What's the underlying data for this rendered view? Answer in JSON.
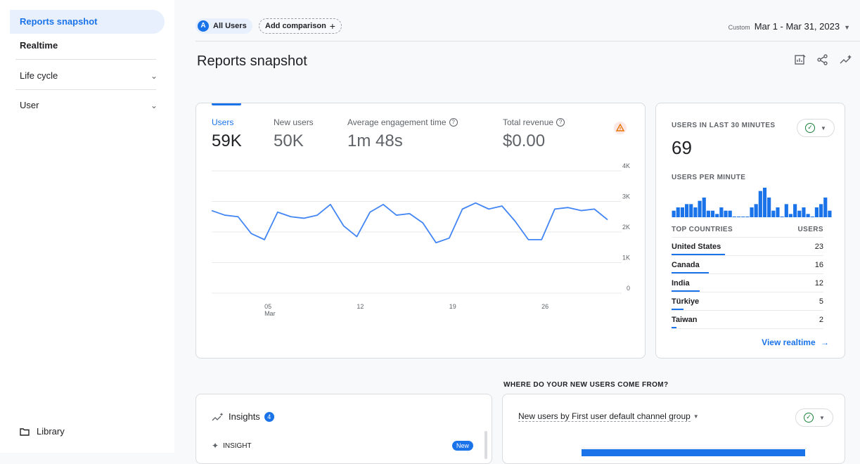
{
  "sidebar": {
    "items": [
      {
        "label": "Reports snapshot"
      },
      {
        "label": "Realtime"
      },
      {
        "label": "Life cycle"
      },
      {
        "label": "User"
      }
    ],
    "library_label": "Library"
  },
  "header": {
    "segment_initial": "A",
    "segment_label": "All Users",
    "add_comparison_label": "Add comparison",
    "date_prefix": "Custom",
    "date_range": "Mar 1 - Mar 31, 2023"
  },
  "page": {
    "title": "Reports snapshot"
  },
  "metrics": [
    {
      "label": "Users",
      "value": "59K"
    },
    {
      "label": "New users",
      "value": "50K"
    },
    {
      "label": "Average engagement time",
      "value": "1m 48s"
    },
    {
      "label": "Total revenue",
      "value": "$0.00"
    }
  ],
  "chart_data": {
    "type": "line",
    "x": [
      "01",
      "02",
      "03",
      "04",
      "05",
      "06",
      "07",
      "08",
      "09",
      "10",
      "11",
      "12",
      "13",
      "14",
      "15",
      "16",
      "17",
      "18",
      "19",
      "20",
      "21",
      "22",
      "23",
      "24",
      "25",
      "26",
      "27",
      "28",
      "29",
      "30",
      "31"
    ],
    "x_tick_labels": [
      {
        "at": "05",
        "label": "05",
        "sub": "Mar"
      },
      {
        "at": "12",
        "label": "12"
      },
      {
        "at": "19",
        "label": "19"
      },
      {
        "at": "26",
        "label": "26"
      }
    ],
    "series": [
      {
        "color": "#4285f4",
        "values": [
          2700,
          2550,
          2500,
          1950,
          1750,
          2650,
          2500,
          2450,
          2550,
          2900,
          2200,
          1850,
          2650,
          2900,
          2550,
          2600,
          2300,
          1650,
          1800,
          2750,
          2950,
          2750,
          2850,
          2350,
          1750,
          1750,
          2750,
          2800,
          2700,
          2750,
          2400
        ]
      }
    ],
    "ylim": [
      0,
      4000
    ],
    "y_ticks": [
      {
        "v": 0,
        "label": "0"
      },
      {
        "v": 1000,
        "label": "1K"
      },
      {
        "v": 2000,
        "label": "2K"
      },
      {
        "v": 3000,
        "label": "3K"
      },
      {
        "v": 4000,
        "label": "4K"
      }
    ],
    "grid": true
  },
  "realtime": {
    "title": "USERS IN LAST 30 MINUTES",
    "value": "69",
    "per_minute_label": "USERS PER MINUTE",
    "per_minute": [
      2,
      3,
      3,
      4,
      4,
      3,
      5,
      6,
      2,
      2,
      1,
      3,
      2,
      2,
      0,
      0,
      0,
      0,
      3,
      4,
      8,
      9,
      6,
      2,
      3,
      0,
      4,
      1,
      4,
      2,
      3,
      1,
      0,
      3,
      4,
      6,
      2
    ],
    "countries_header": "TOP COUNTRIES",
    "users_header": "USERS",
    "countries": [
      {
        "name": "United States",
        "value": "23",
        "frac": 1.0
      },
      {
        "name": "Canada",
        "value": "16",
        "frac": 0.7
      },
      {
        "name": "India",
        "value": "12",
        "frac": 0.52
      },
      {
        "name": "Türkiye",
        "value": "5",
        "frac": 0.22
      },
      {
        "name": "Taiwan",
        "value": "2",
        "frac": 0.09
      }
    ],
    "view_link": "View realtime"
  },
  "insights": {
    "title": "Insights",
    "count": "4",
    "insight_label": "INSIGHT",
    "new_badge": "New"
  },
  "new_users": {
    "section_title": "WHERE DO YOUR NEW USERS COME FROM?",
    "dropdown_label": "New users by First user default channel group"
  },
  "colors": {
    "accent": "#1a73e8",
    "line": "#4285f4",
    "warning": "#e37400",
    "success": "#188038"
  }
}
